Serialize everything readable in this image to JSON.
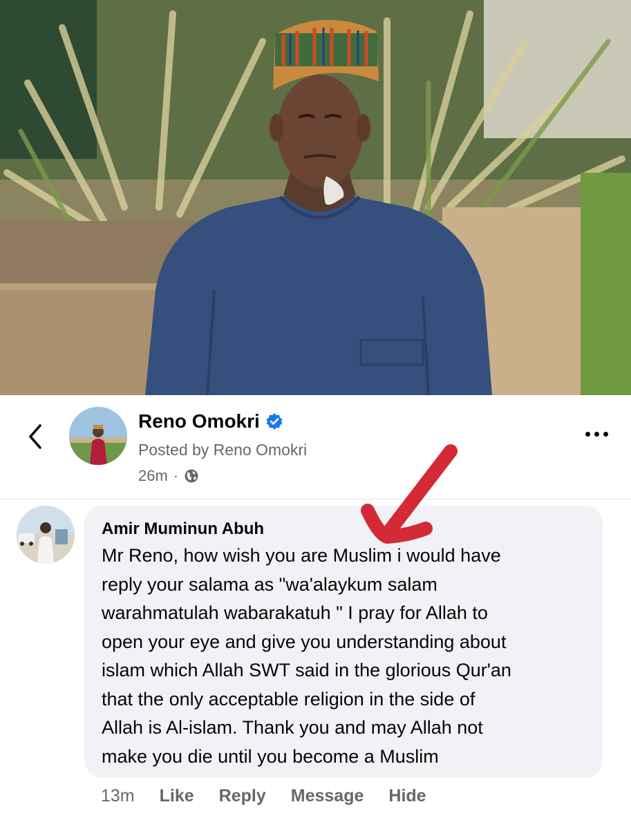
{
  "post": {
    "author_name": "Reno Omokri",
    "posted_by": "Posted by Reno Omokri",
    "time": "26m",
    "separator": "·",
    "privacy_icon": "globe-icon",
    "verified_icon": "verified-badge-icon"
  },
  "comment": {
    "author_name": "Amir Muminun Abuh",
    "lines": [
      "Mr Reno, how wish you are Muslim i would have",
      "reply your salama as \"wa'alaykum salam",
      "warahmatulah wabarakatuh \" I pray for Allah to",
      "open your eye and give you understanding about",
      "islam which Allah SWT said in the glorious Qur'an",
      "that the only acceptable religion in the side of",
      "Allah is Al-islam. Thank you and may Allah not",
      "make you die until you become a Muslim"
    ],
    "time": "13m",
    "actions": {
      "like": "Like",
      "reply": "Reply",
      "message": "Message",
      "hide": "Hide"
    }
  },
  "colors": {
    "verified_blue": "#1877f2",
    "bubble_bg": "#f0f2f5",
    "secondary_text": "#65676b",
    "annotation_red": "#d42a35"
  }
}
